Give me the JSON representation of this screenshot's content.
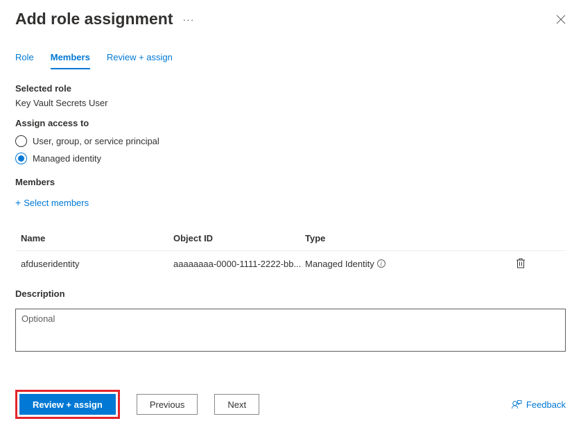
{
  "header": {
    "title": "Add role assignment"
  },
  "tabs": {
    "role": "Role",
    "members": "Members",
    "review": "Review + assign"
  },
  "sections": {
    "selected_role_label": "Selected role",
    "selected_role_value": "Key Vault Secrets User",
    "assign_access_label": "Assign access to",
    "radio_user": "User, group, or service principal",
    "radio_managed": "Managed identity",
    "members_label": "Members",
    "select_members": "Select members",
    "description_label": "Description",
    "description_placeholder": "Optional"
  },
  "table": {
    "headers": {
      "name": "Name",
      "object_id": "Object ID",
      "type": "Type"
    },
    "rows": [
      {
        "name": "afduseridentity",
        "object_id": "aaaaaaaa-0000-1111-2222-bb...",
        "type": "Managed Identity"
      }
    ]
  },
  "footer": {
    "review": "Review + assign",
    "previous": "Previous",
    "next": "Next",
    "feedback": "Feedback"
  }
}
